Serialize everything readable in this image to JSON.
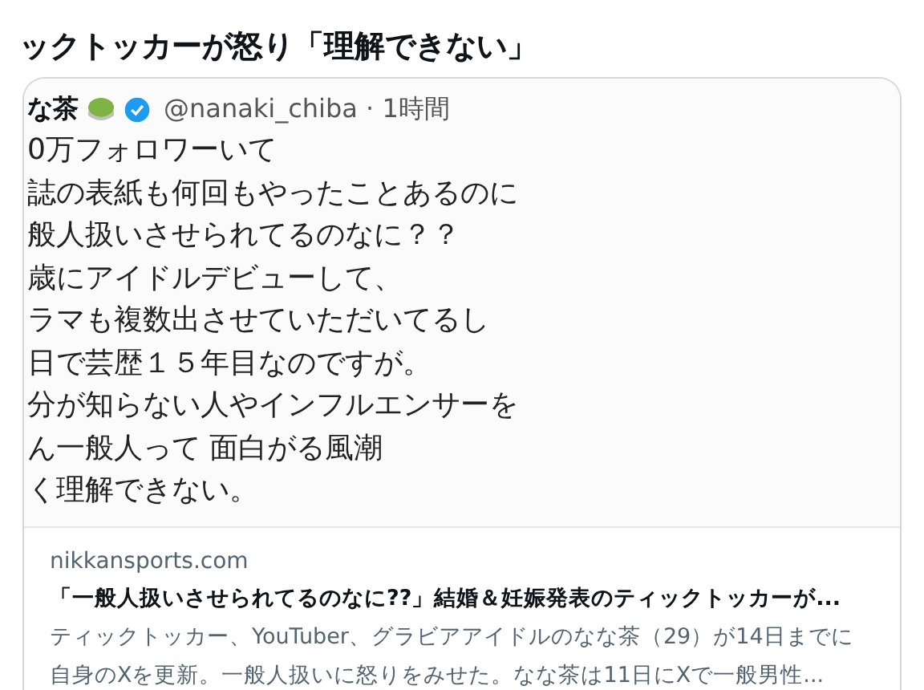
{
  "headline": "ックトッカーが怒り「理解できない」",
  "tweet_image": {
    "name": "な茶",
    "verified": true,
    "handle": "@nanaki_chiba · 1時間",
    "lines": [
      "0万フォロワーいて",
      "誌の表紙も何回もやったことあるのに",
      "般人扱いさせられてるのなに？？",
      "歳にアイドルデビューして、",
      "ラマも複数出させていただいてるし",
      "日で芸歴１５年目なのですが。",
      "分が知らない人やインフルエンサーを",
      "ん一般人って 面白がる風潮",
      "く理解できない。"
    ]
  },
  "link_card": {
    "domain": "nikkansports.com",
    "title": "「一般人扱いさせられてるのなに??」結婚＆妊娠発表のティックトッカーが...",
    "description": "ティックトッカー、YouTuber、グラビアアイドルのなな茶（29）が14日までに自身のXを更新。一般人扱いに怒りをみせた。なな茶は11日にXで一般男性..."
  }
}
